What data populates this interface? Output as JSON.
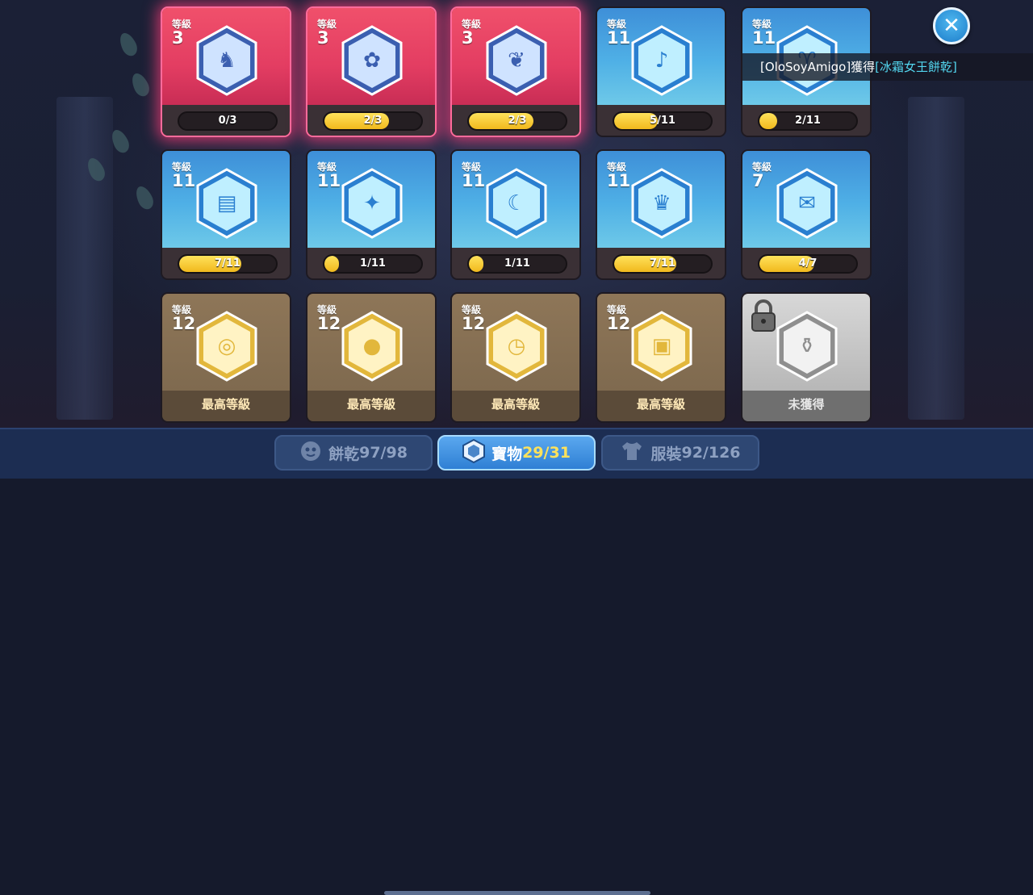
{
  "level_word": "等級",
  "cards": [
    {
      "tier": "red",
      "level": "3",
      "progress_text": "0/3",
      "progress": 0.0,
      "icon": "horse-mask-icon",
      "glyph": "♞"
    },
    {
      "tier": "red",
      "level": "3",
      "progress_text": "2/3",
      "progress": 0.67,
      "icon": "flower-wreath-icon",
      "glyph": "✿"
    },
    {
      "tier": "red",
      "level": "3",
      "progress_text": "2/3",
      "progress": 0.67,
      "icon": "coral-branch-icon",
      "glyph": "❦"
    },
    {
      "tier": "blue",
      "level": "11",
      "progress_text": "5/11",
      "progress": 0.45,
      "icon": "horn-icon",
      "glyph": "♪"
    },
    {
      "tier": "blue",
      "level": "11",
      "progress_text": "2/11",
      "progress": 0.18,
      "icon": "ram-mask-icon",
      "glyph": "♈"
    },
    {
      "tier": "blue",
      "level": "11",
      "progress_text": "7/11",
      "progress": 0.64,
      "icon": "calendar-icon",
      "glyph": "▤"
    },
    {
      "tier": "blue",
      "level": "11",
      "progress_text": "1/11",
      "progress": 0.09,
      "icon": "chick-icon",
      "glyph": "✦"
    },
    {
      "tier": "blue",
      "level": "11",
      "progress_text": "1/11",
      "progress": 0.09,
      "icon": "scythe-bone-icon",
      "glyph": "☾"
    },
    {
      "tier": "blue",
      "level": "11",
      "progress_text": "7/11",
      "progress": 0.64,
      "icon": "dark-crown-icon",
      "glyph": "♛"
    },
    {
      "tier": "blue",
      "level": "7",
      "progress_text": "4/7",
      "progress": 0.57,
      "icon": "scroll-icon",
      "glyph": "✉"
    },
    {
      "tier": "gold",
      "level": "12",
      "max_text": "最高等級",
      "icon": "ribbon-roll-icon",
      "glyph": "◎"
    },
    {
      "tier": "gold",
      "level": "12",
      "max_text": "最高等級",
      "icon": "yellow-bird-icon",
      "glyph": "●"
    },
    {
      "tier": "gold",
      "level": "12",
      "max_text": "最高等級",
      "icon": "pocket-watch-icon",
      "glyph": "◷"
    },
    {
      "tier": "gold",
      "level": "12",
      "max_text": "最高等級",
      "icon": "treasure-chest-icon",
      "glyph": "▣"
    },
    {
      "tier": "grey",
      "locked": true,
      "max_text": "未獲得",
      "icon": "locked-treasure-icon",
      "glyph": "⚱"
    }
  ],
  "notice": {
    "prefix": "[OloSoyAmigo]獲得",
    "highlight": "[冰霜女王餅乾]"
  },
  "close_icon": "close-icon",
  "tabs": [
    {
      "label": "餅乾",
      "count": "97/98",
      "active": false,
      "icon": "cookie-face-icon"
    },
    {
      "label": "寶物",
      "count": "29/31",
      "active": true,
      "icon": "hexagon-treasure-icon"
    },
    {
      "label": "服裝",
      "count": "92/126",
      "active": false,
      "icon": "shirt-icon"
    }
  ]
}
